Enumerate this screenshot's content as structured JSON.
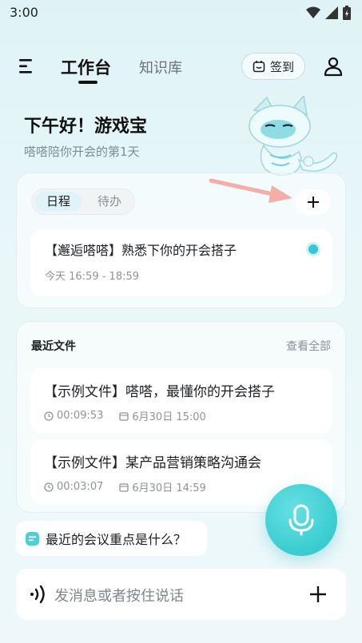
{
  "status_bar": {
    "time": "3:00"
  },
  "header": {
    "tab_work": "工作台",
    "tab_knowledge": "知识库",
    "signin_label": "签到"
  },
  "greeting": {
    "title": "下午好！游戏宝",
    "subtitle": "嗒嗒陪你开会的第1天"
  },
  "schedule": {
    "tabs": [
      "日程",
      "待办"
    ],
    "events": [
      {
        "title": "【邂逅嗒嗒】熟悉下你的开会搭子",
        "time": "今天 16:59 - 18:59"
      }
    ]
  },
  "files": {
    "title": "最近文件",
    "view_all": "查看全部",
    "items": [
      {
        "name": "【示例文件】嗒嗒，最懂你的开会搭子",
        "duration": "00:09:53",
        "date": "6月30日 15:00"
      },
      {
        "name": "【示例文件】某产品营销策略沟通会",
        "duration": "00:03:07",
        "date": "6月30日 14:59"
      }
    ]
  },
  "suggestion": {
    "text": "最近的会议重点是什么？"
  },
  "input": {
    "placeholder": "发消息或者按住说话"
  },
  "colors": {
    "accent": "#3fcfd3",
    "arrow": "#e84a3f"
  }
}
